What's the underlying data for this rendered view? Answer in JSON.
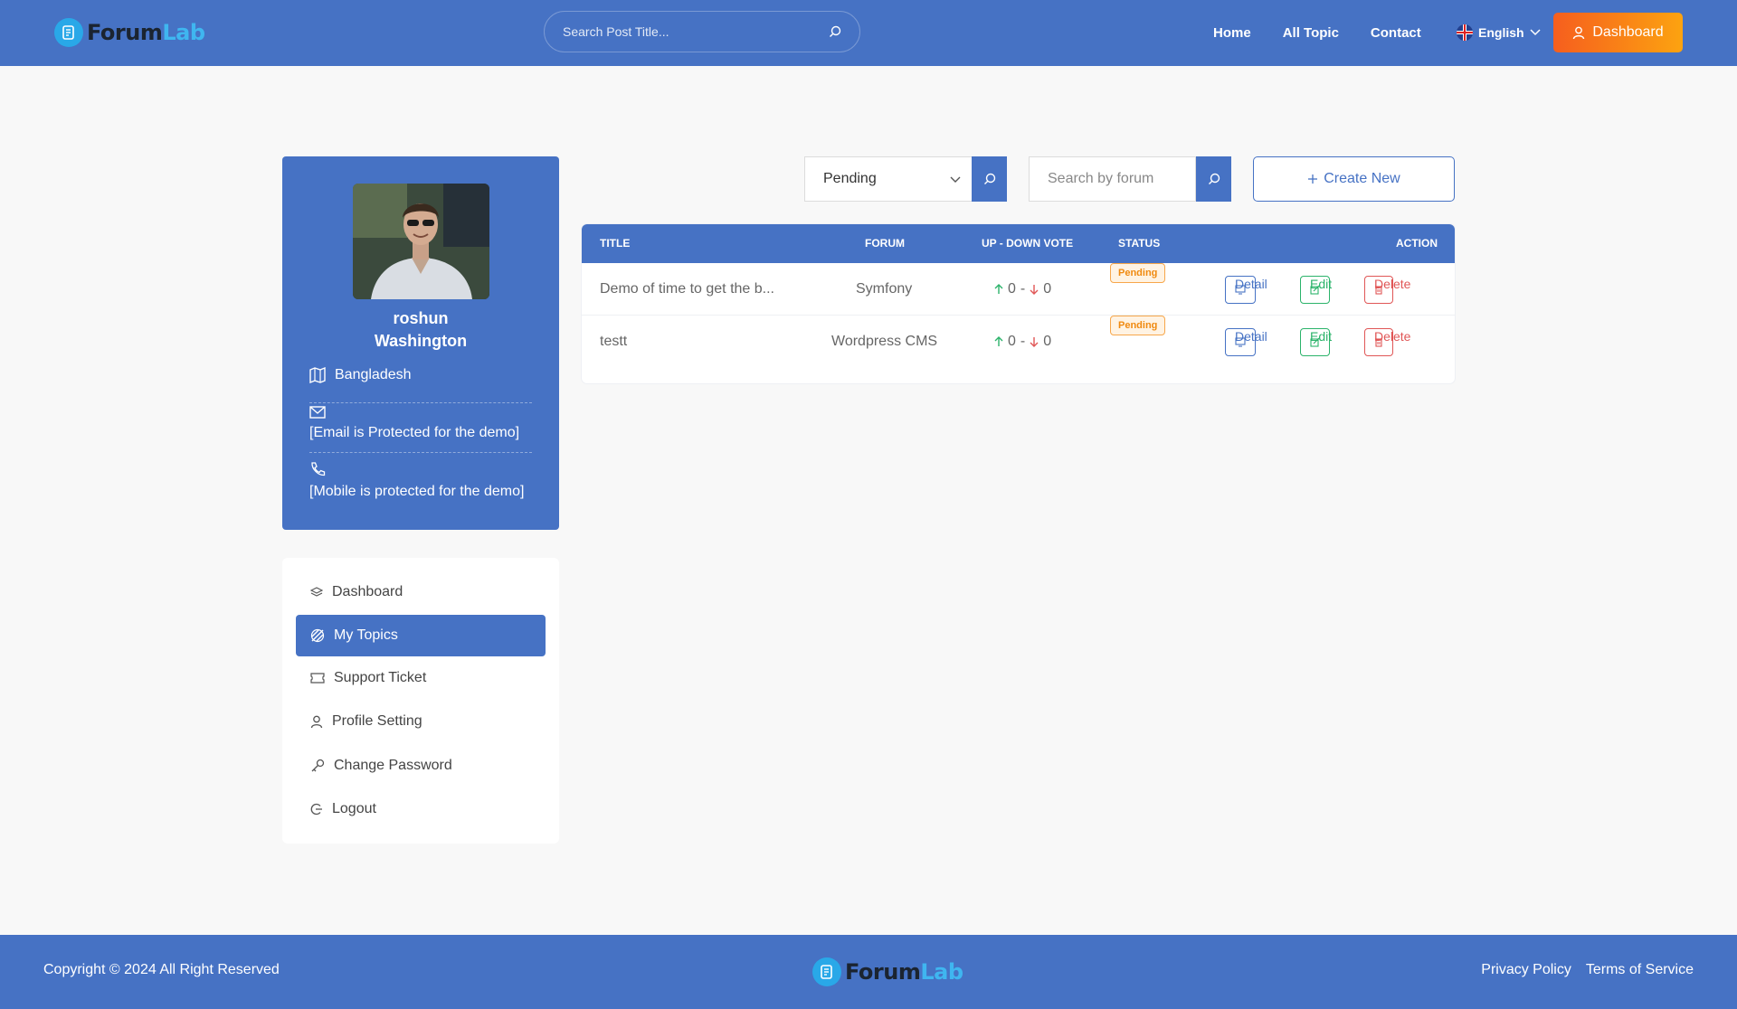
{
  "header": {
    "logo_a": "Forum",
    "logo_b": "Lab",
    "search_placeholder": "Search Post Title...",
    "nav": [
      "Home",
      "All Topic",
      "Contact"
    ],
    "language": "English",
    "dashboard_label": "Dashboard"
  },
  "profile": {
    "first_name": "roshun",
    "last_name": "Washington",
    "country": "Bangladesh",
    "email": "[Email is Protected for the demo]",
    "mobile": "[Mobile is protected for the demo]"
  },
  "menu": [
    "Dashboard",
    "My Topics",
    "Support Ticket",
    "Profile Setting",
    "Change Password",
    "Logout"
  ],
  "filters": {
    "status_selected": "Pending",
    "forum_placeholder": "Search by forum",
    "create_label": "Create New"
  },
  "table": {
    "headers": [
      "TITLE",
      "FORUM",
      "UP - DOWN VOTE",
      "STATUS",
      "ACTION"
    ],
    "vote_separator": "-",
    "rows": [
      {
        "title": "Demo of time to get the b...",
        "forum": "Symfony",
        "up": "0",
        "down": "0",
        "status": "Pending"
      },
      {
        "title": "testt",
        "forum": "Wordpress CMS",
        "up": "0",
        "down": "0",
        "status": "Pending"
      }
    ],
    "actions": {
      "detail": "Detail",
      "edit": "Edit",
      "delete": "Delete"
    }
  },
  "footer": {
    "copyright": "Copyright © 2024 All Right Reserved",
    "links": [
      "Privacy Policy",
      "Terms of Service"
    ]
  }
}
